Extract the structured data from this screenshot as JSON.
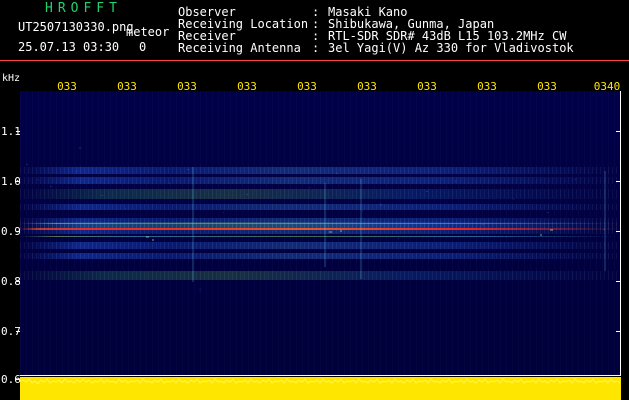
{
  "header": {
    "app_title": "HROFFT",
    "file_name": "UT2507130330.png",
    "meteor_label": "meteor",
    "datetime": "25.07.13 03:30",
    "datetime_extra": "0",
    "observer_label": "Observer",
    "observer_value": "Masaki Kano",
    "receiving_location_label": "Receiving Location",
    "receiving_location_value": "Shibukawa, Gunma, Japan",
    "receiver_label": "Receiver",
    "receiver_value": "RTL-SDR SDR# 43dB L15 103.2MHz CW",
    "receiving_antenna_label": "Receiving Antenna",
    "receiving_antenna_value": "3el Yagi(V) Az 330 for Vladivostok",
    "separator": ":"
  },
  "axes": {
    "unit": "kHz",
    "time_labels": [
      "033",
      "033",
      "033",
      "033",
      "033",
      "033",
      "033",
      "033",
      "033",
      "0340"
    ],
    "frequency_labels": [
      "1.1",
      "1.0",
      "0.9",
      "0.8",
      "0.7",
      "0.6"
    ]
  },
  "colors": {
    "accent_title": "#22d26a",
    "time_axis": "#ffe600",
    "top_rule": "#ff4444",
    "plot_bg": "#000050",
    "bottom_strip": "#ffe600"
  },
  "icons": {
    "waterfall": "waterfall-display"
  }
}
